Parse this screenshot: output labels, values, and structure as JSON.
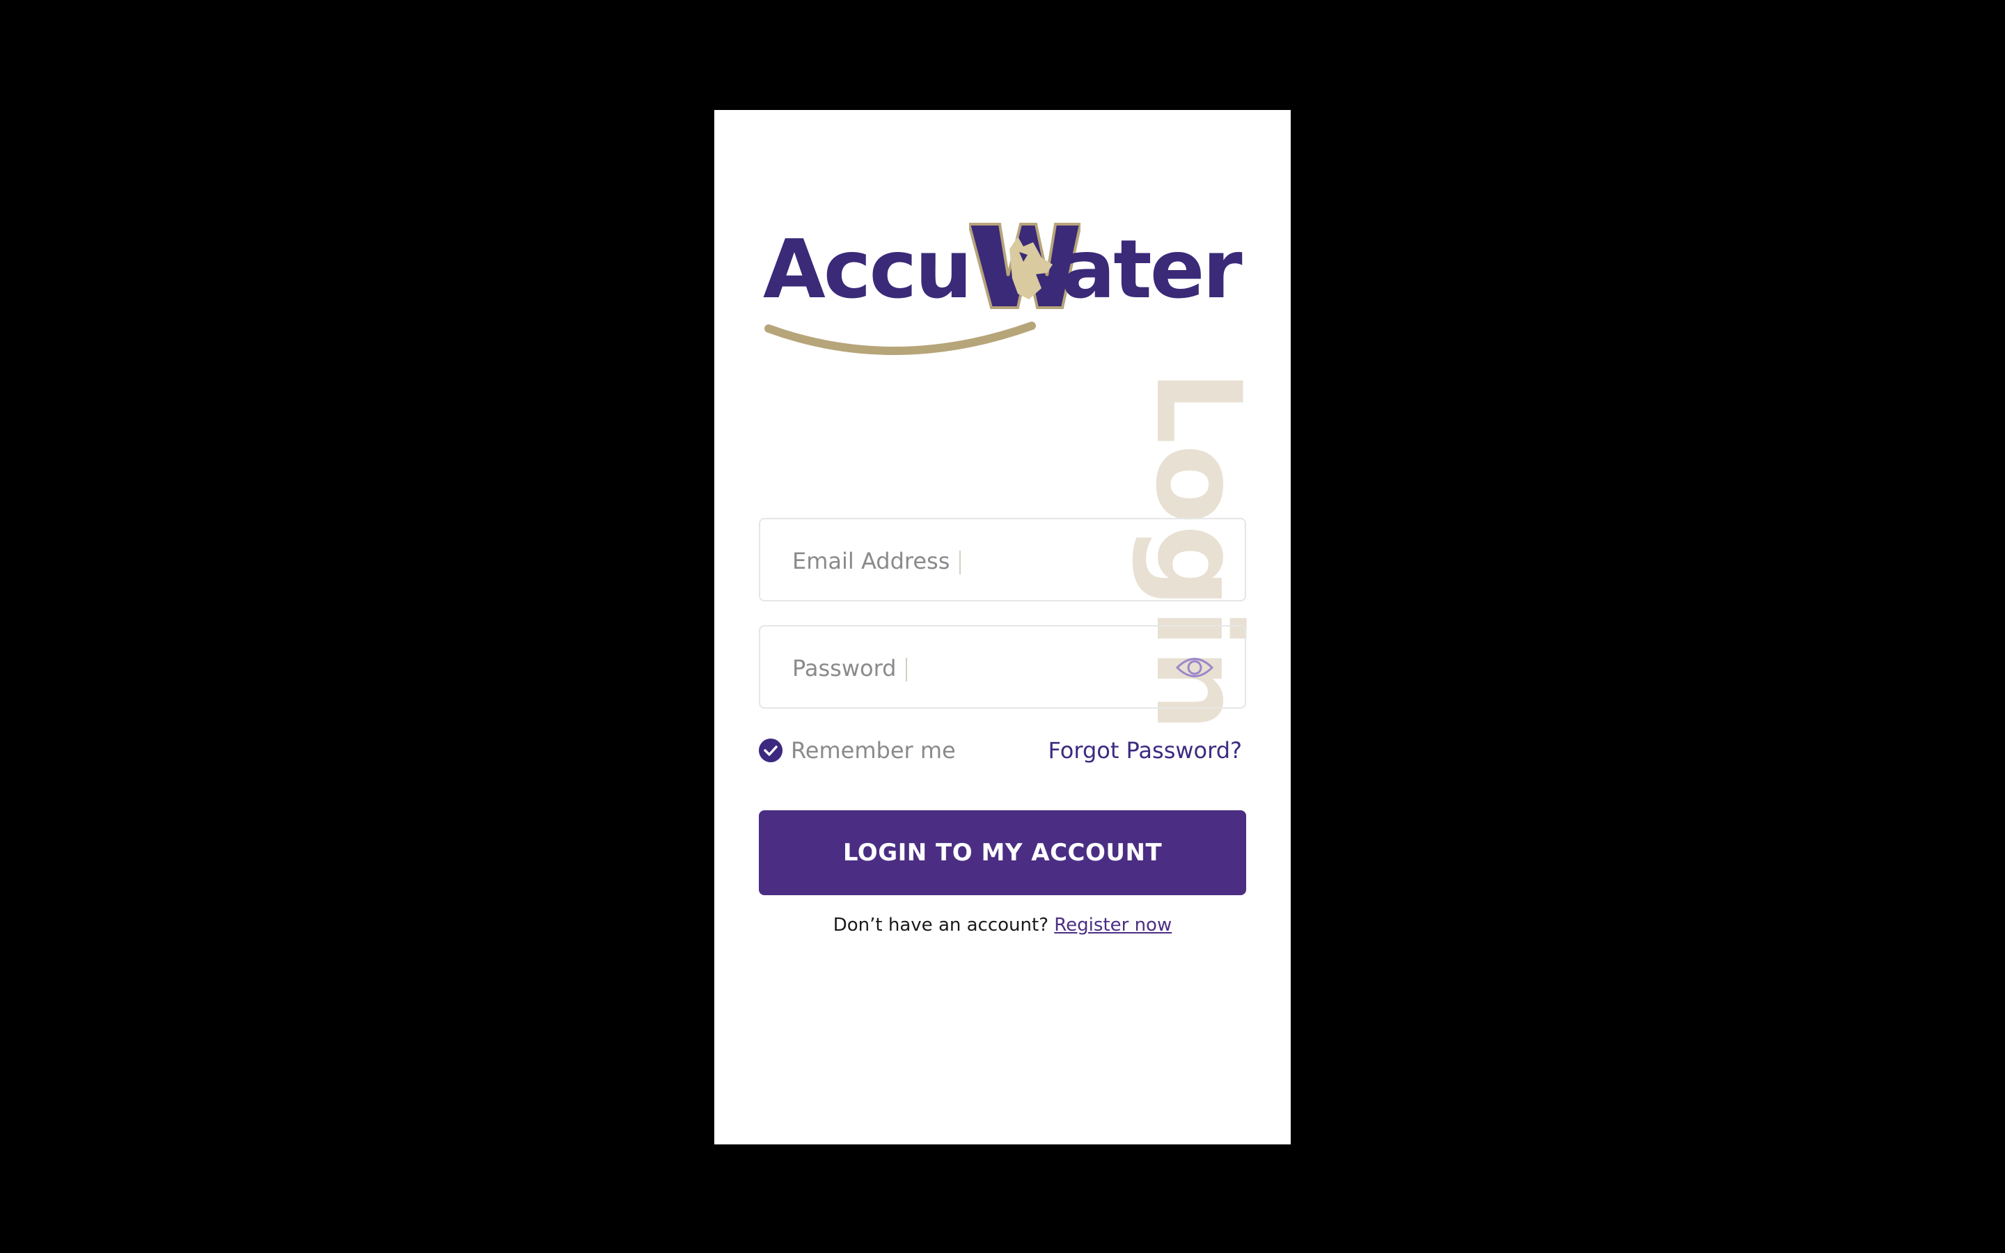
{
  "logo": {
    "text_left": "Accu",
    "text_right": "ater",
    "emblem_icon": "husky-w-emblem",
    "brand_purple": "#3a2a78",
    "brand_gold": "#b7a57a"
  },
  "page": {
    "vertical_title": "Login"
  },
  "form": {
    "email_placeholder": "Email Address",
    "password_placeholder": "Password",
    "password_toggle_icon": "eye-icon",
    "remember_label": "Remember me",
    "remember_checked": true,
    "forgot_label": "Forgot Password?",
    "submit_label": "LOGIN TO MY ACCOUNT"
  },
  "register": {
    "prompt": "Don’t have an account?",
    "link_label": "Register now"
  },
  "colors": {
    "accent": "#4b2e83",
    "title_watermark": "#e8e0d2",
    "placeholder": "#8a8a8a"
  }
}
